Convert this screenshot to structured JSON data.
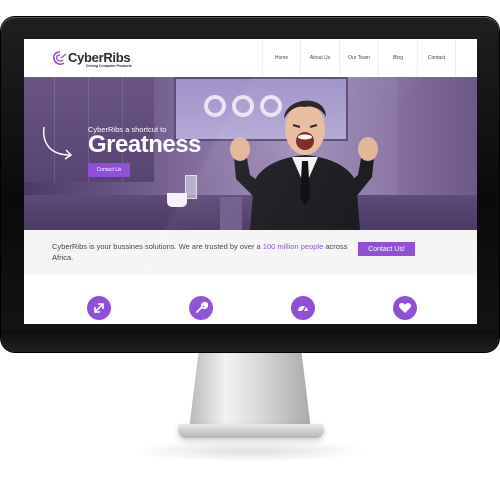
{
  "site": {
    "logo_name": "CyberRibs",
    "logo_tagline": "Driving Computer Products",
    "brand_color": "#8f4fd6"
  },
  "nav": {
    "items": [
      {
        "label": "Home"
      },
      {
        "label": "About Us"
      },
      {
        "label": "Our Team"
      },
      {
        "label": "Blog"
      },
      {
        "label": "Contact"
      }
    ]
  },
  "hero": {
    "subtitle": "CyberRibs a shortcut to",
    "title": "Greatness",
    "button_label": "Contact Us"
  },
  "info": {
    "text_before": "CyberRibs is your bussines solutions. We are trusted by over a ",
    "highlight": "100 million people",
    "text_after": " across Africa.",
    "button_label": "Contact Us!"
  },
  "features": {
    "icons": [
      {
        "name": "expand-arrows-icon"
      },
      {
        "name": "wrench-icon"
      },
      {
        "name": "dashboard-gauge-icon"
      },
      {
        "name": "heart-icon"
      }
    ]
  }
}
